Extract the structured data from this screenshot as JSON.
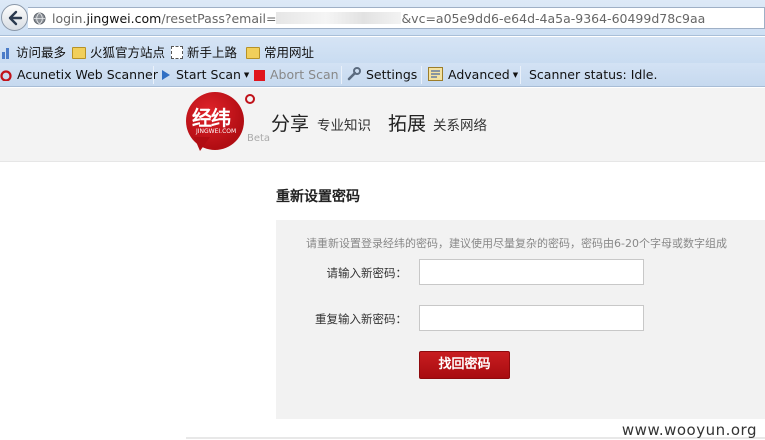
{
  "address_bar": {
    "url_prefix": "login.",
    "url_domain": "jingwei.com",
    "url_path": "/resetPass?email=",
    "url_suffix": "&vc=a05e9dd6-e64d-4a5a-9364-60499d78c9aa"
  },
  "bookmarks": [
    {
      "label": "访问最多",
      "icon": "most-visited-icon"
    },
    {
      "label": "火狐官方站点",
      "icon": "folder-icon"
    },
    {
      "label": "新手上路",
      "icon": "page-icon"
    },
    {
      "label": "常用网址",
      "icon": "folder-icon"
    }
  ],
  "scanner_toolbar": {
    "name": "Acunetix Web Scanner",
    "start_scan": "Start Scan",
    "abort_scan": "Abort Scan",
    "settings": "Settings",
    "advanced": "Advanced",
    "status": "Scanner status: Idle."
  },
  "site_header": {
    "logo_cn": "经纬",
    "logo_en": "JINGWEI.COM",
    "beta": "Beta",
    "nav": [
      {
        "title": "分享",
        "subtitle": "专业知识"
      },
      {
        "title": "拓展",
        "subtitle": "关系网络"
      }
    ]
  },
  "reset_form": {
    "title": "重新设置密码",
    "hint": "请重新设置登录经纬的密码，建议使用尽量复杂的密码，密码由6-20个字母或数字组成",
    "new_password_label": "请输入新密码：",
    "new_password_value": "",
    "repeat_password_label": "重复输入新密码：",
    "repeat_password_value": "",
    "submit_label": "找回密码"
  },
  "watermark": "www.wooyun.org",
  "colors": {
    "brand_red": "#c0121a",
    "toolbar_blue": "#cddff3",
    "panel_gray": "#f2f2f2"
  }
}
